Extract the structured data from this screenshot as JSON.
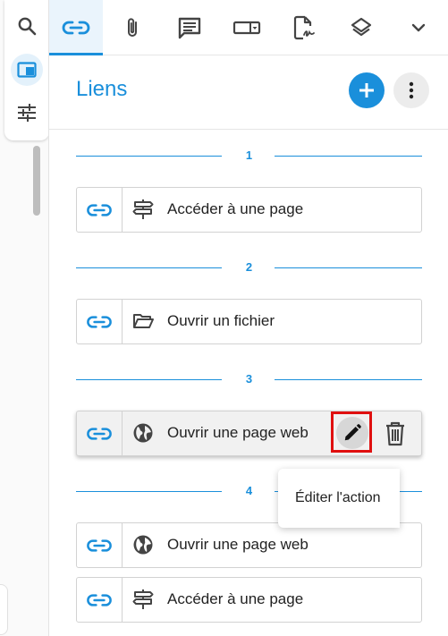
{
  "left_toolbar": {
    "items": [
      {
        "icon": "search-icon"
      },
      {
        "icon": "panel-icon",
        "active": true
      },
      {
        "icon": "sliders-icon"
      }
    ]
  },
  "tabs": [
    {
      "icon": "link-icon",
      "active": true
    },
    {
      "icon": "paperclip-icon"
    },
    {
      "icon": "comment-icon"
    },
    {
      "icon": "form-field-icon"
    },
    {
      "icon": "signature-icon"
    },
    {
      "icon": "layers-icon"
    },
    {
      "icon": "chevron-down-icon"
    }
  ],
  "panel": {
    "title": "Liens"
  },
  "groups": [
    {
      "number": "1",
      "items": [
        {
          "label": "Accéder à une page",
          "type_icon": "signpost-icon"
        }
      ]
    },
    {
      "number": "2",
      "items": [
        {
          "label": "Ouvrir un fichier",
          "type_icon": "folder-open-icon"
        }
      ]
    },
    {
      "number": "3",
      "items": [
        {
          "label": "Ouvrir une page web",
          "type_icon": "globe-icon",
          "hovered": true
        }
      ]
    },
    {
      "number": "4",
      "items": [
        {
          "label": "Ouvrir une page web",
          "type_icon": "globe-icon"
        },
        {
          "label": "Accéder à une page",
          "type_icon": "signpost-icon"
        }
      ]
    }
  ],
  "tooltip": {
    "text": "Éditer l'action"
  },
  "colors": {
    "accent": "#1a8fdb",
    "highlight": "#e01010"
  }
}
